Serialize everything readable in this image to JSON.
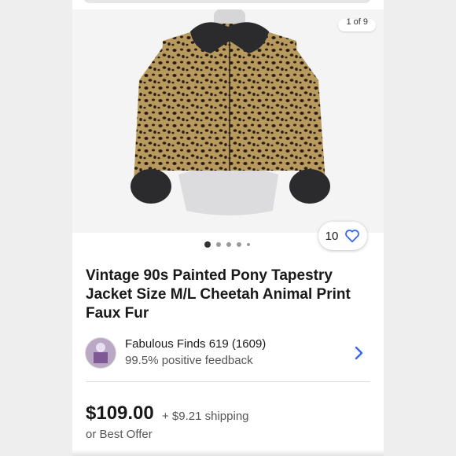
{
  "gallery": {
    "counter": "1 of 9",
    "dots": [
      true,
      false,
      false,
      false,
      false
    ],
    "watch_count": "10"
  },
  "listing": {
    "title": "Vintage 90s Painted Pony Tapestry Jacket Size M/L Cheetah Animal Print Faux Fur"
  },
  "seller": {
    "name": "Fabulous Finds 619 (1609)",
    "feedback": "99.5% positive feedback"
  },
  "pricing": {
    "price": "$109.00",
    "shipping": "+ $9.21 shipping",
    "offer": "or Best Offer"
  },
  "colors": {
    "accent": "#3665f3",
    "text": "#191919",
    "secondary_text": "#555555"
  }
}
